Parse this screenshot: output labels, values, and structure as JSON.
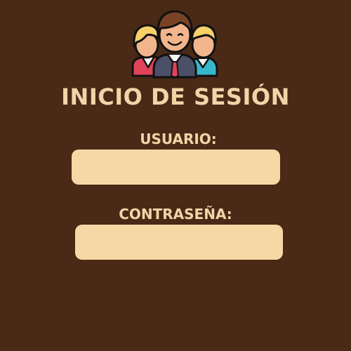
{
  "login": {
    "title": "INICIO DE SESIÓN",
    "user_label": "USUARIO:",
    "user_value": "",
    "password_label": "CONTRASEÑA:",
    "password_value": ""
  },
  "icons": {
    "logo": "users-group-icon"
  },
  "colors": {
    "background": "#4a2916",
    "text": "#efd6a8",
    "field_fill": "#f6d8a6"
  }
}
